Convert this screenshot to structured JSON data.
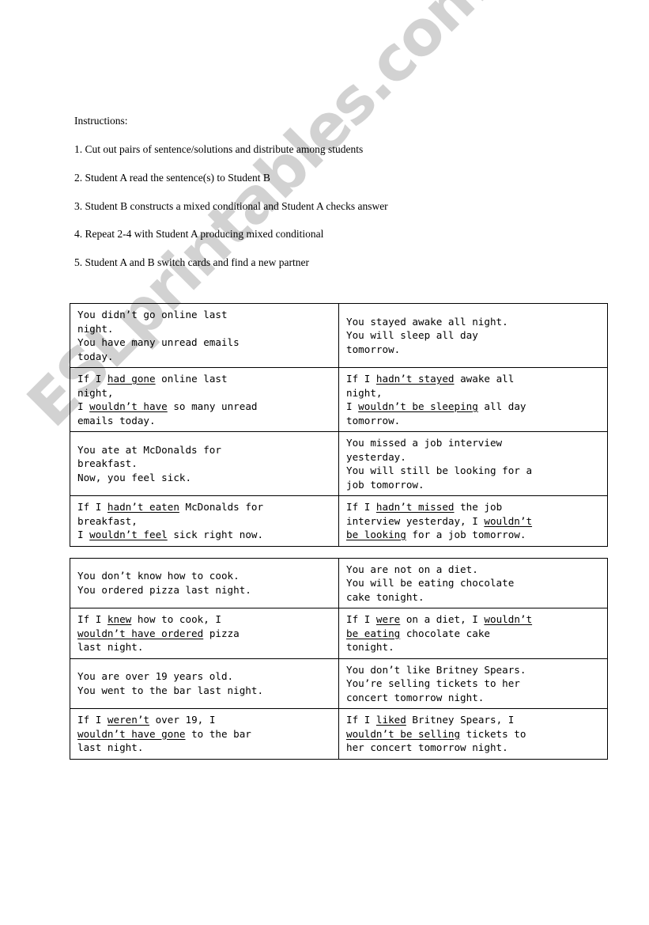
{
  "watermark": {
    "text": "ESLprintables.com",
    "color": "#d2d2d2"
  },
  "instructions": {
    "heading": "Instructions:",
    "steps": [
      "1. Cut out pairs of sentence/solutions and distribute among students",
      "2. Student A read the sentence(s) to Student B",
      "3. Student B constructs a mixed conditional and Student A checks answer",
      "4. Repeat 2-4 with Student A producing mixed conditional",
      "5. Student A and B switch cards and find a new partner"
    ]
  },
  "tables": [
    {
      "rows": [
        {
          "left": {
            "align": "top",
            "lines": [
              "You didn’t go online last",
              "night.",
              "You have many unread emails",
              "today."
            ]
          },
          "right": {
            "align": "middle",
            "lines": [
              "You stayed awake all night.",
              "You will sleep all day",
              "tomorrow."
            ]
          }
        },
        {
          "left": {
            "align": "top",
            "segments": [
              [
                {
                  "t": "If I ",
                  "u": false
                },
                {
                  "t": "had gone",
                  "u": true
                },
                {
                  "t": " online last",
                  "u": false
                }
              ],
              [
                {
                  "t": "night,",
                  "u": false
                }
              ],
              [
                {
                  "t": "I ",
                  "u": false
                },
                {
                  "t": "wouldn’t have",
                  "u": true
                },
                {
                  "t": " so many unread",
                  "u": false
                }
              ],
              [
                {
                  "t": "emails today.",
                  "u": false
                }
              ]
            ]
          },
          "right": {
            "align": "top",
            "segments": [
              [
                {
                  "t": "If I ",
                  "u": false
                },
                {
                  "t": "hadn’t stayed",
                  "u": true
                },
                {
                  "t": " awake all",
                  "u": false
                }
              ],
              [
                {
                  "t": "night,",
                  "u": false
                }
              ],
              [
                {
                  "t": "I ",
                  "u": false
                },
                {
                  "t": "wouldn’t be sleeping",
                  "u": true
                },
                {
                  "t": " all day",
                  "u": false
                }
              ],
              [
                {
                  "t": "tomorrow.",
                  "u": false
                }
              ]
            ]
          }
        },
        {
          "left": {
            "align": "middle",
            "lines": [
              "You ate at McDonalds for",
              "breakfast.",
              "Now, you feel sick."
            ]
          },
          "right": {
            "align": "top",
            "lines": [
              "You missed a job interview",
              "yesterday.",
              "You will still be looking for a",
              "job tomorrow."
            ]
          }
        },
        {
          "left": {
            "align": "middle",
            "segments": [
              [
                {
                  "t": "If I ",
                  "u": false
                },
                {
                  "t": "hadn’t eaten",
                  "u": true
                },
                {
                  "t": " McDonalds for",
                  "u": false
                }
              ],
              [
                {
                  "t": "breakfast,",
                  "u": false
                }
              ],
              [
                {
                  "t": "I ",
                  "u": false
                },
                {
                  "t": "wouldn’t feel",
                  "u": true
                },
                {
                  "t": " sick right now.",
                  "u": false
                }
              ]
            ]
          },
          "right": {
            "align": "top",
            "segments": [
              [
                {
                  "t": "If I ",
                  "u": false
                },
                {
                  "t": "hadn’t missed",
                  "u": true
                },
                {
                  "t": " the job",
                  "u": false
                }
              ],
              [
                {
                  "t": "interview yesterday, I ",
                  "u": false
                },
                {
                  "t": "wouldn’t",
                  "u": true
                }
              ],
              [
                {
                  "t": "be looking",
                  "u": true
                },
                {
                  "t": " for a job tomorrow.",
                  "u": false
                }
              ]
            ]
          }
        }
      ]
    },
    {
      "rows": [
        {
          "left": {
            "align": "middle",
            "lines": [
              "You don’t know how to cook.",
              "You ordered pizza last night."
            ]
          },
          "right": {
            "align": "top",
            "lines": [
              "You are not on a diet.",
              "You will be eating chocolate",
              "cake tonight."
            ]
          }
        },
        {
          "left": {
            "align": "middle",
            "segments": [
              [
                {
                  "t": "If I ",
                  "u": false
                },
                {
                  "t": "knew",
                  "u": true
                },
                {
                  "t": " how to cook, I",
                  "u": false
                }
              ],
              [
                {
                  "t": "wouldn’t have ordered",
                  "u": true
                },
                {
                  "t": " pizza",
                  "u": false
                }
              ],
              [
                {
                  "t": "last night.",
                  "u": false
                }
              ]
            ]
          },
          "right": {
            "align": "top",
            "segments": [
              [
                {
                  "t": "If I ",
                  "u": false
                },
                {
                  "t": "were",
                  "u": true
                },
                {
                  "t": " on a diet, I ",
                  "u": false
                },
                {
                  "t": "wouldn’t",
                  "u": true
                }
              ],
              [
                {
                  "t": "be eating",
                  "u": true
                },
                {
                  "t": " chocolate cake",
                  "u": false
                }
              ],
              [
                {
                  "t": "tonight.",
                  "u": false
                }
              ]
            ]
          }
        },
        {
          "left": {
            "align": "middle",
            "lines": [
              "You are over 19 years old.",
              "You went to the bar last night."
            ]
          },
          "right": {
            "align": "top",
            "lines": [
              "You don’t like Britney Spears.",
              "You’re selling tickets to her",
              "concert tomorrow night."
            ]
          }
        },
        {
          "left": {
            "align": "middle",
            "segments": [
              [
                {
                  "t": "If I ",
                  "u": false
                },
                {
                  "t": "weren’t",
                  "u": true
                },
                {
                  "t": " over 19, I",
                  "u": false
                }
              ],
              [
                {
                  "t": "wouldn’t have gone",
                  "u": true
                },
                {
                  "t": " to the bar",
                  "u": false
                }
              ],
              [
                {
                  "t": "last night.",
                  "u": false
                }
              ]
            ]
          },
          "right": {
            "align": "top",
            "segments": [
              [
                {
                  "t": "If I ",
                  "u": false
                },
                {
                  "t": "liked",
                  "u": true
                },
                {
                  "t": " Britney Spears, I",
                  "u": false
                }
              ],
              [
                {
                  "t": "wouldn’t be selling",
                  "u": true
                },
                {
                  "t": " tickets to",
                  "u": false
                }
              ],
              [
                {
                  "t": "her concert tomorrow night.",
                  "u": false
                }
              ]
            ]
          }
        }
      ]
    }
  ]
}
